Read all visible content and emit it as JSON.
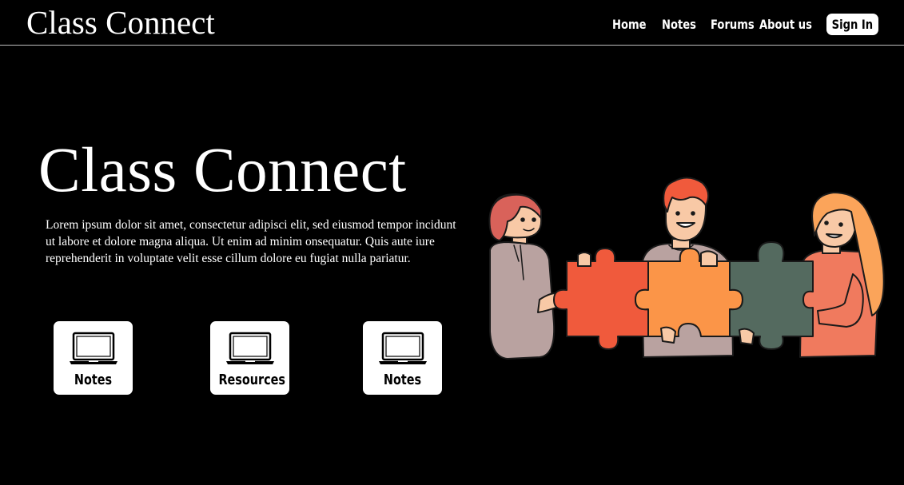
{
  "header": {
    "logo": "Class Connect",
    "nav": [
      {
        "label": "Home"
      },
      {
        "label": "Notes"
      },
      {
        "label": "Forums"
      },
      {
        "label": "About us"
      }
    ],
    "sign_in": "Sign In"
  },
  "hero": {
    "title": "Class Connect",
    "description": "Lorem ipsum dolor sit amet, consectetur adipisci elit, sed eiusmod tempor incidunt ut labore et dolore magna aliqua. Ut enim ad minim onsequatur. Quis aute iure reprehenderit in voluptate velit esse cillum dolore eu fugiat nulla pariatur."
  },
  "cards": [
    {
      "label": "Notes",
      "icon": "laptop-icon"
    },
    {
      "label": "Resources",
      "icon": "laptop-icon"
    },
    {
      "label": "Notes",
      "icon": "laptop-icon"
    }
  ],
  "illustration": {
    "subject": "three-people-holding-puzzle-pieces",
    "colors": {
      "red": "#f05a3c",
      "orange": "#fb9548",
      "green": "#546a5f",
      "skin": "#f8c9a6",
      "grey": "#b9a2a0"
    }
  },
  "theme": {
    "background": "#000000",
    "text": "#ffffff",
    "card": "#ffffff"
  }
}
